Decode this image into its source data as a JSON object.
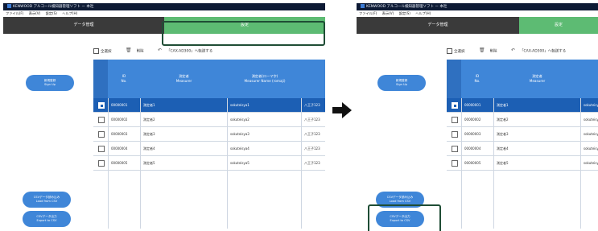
{
  "window": {
    "title": "KENWOOD アルコール検知器管理ソフト  ー 本社",
    "menu": [
      "ファイル(F)",
      "表示(V)",
      "設定(S)",
      "ヘルプ(H)"
    ]
  },
  "tabs": {
    "data_management": "データ管理",
    "settings": "設定"
  },
  "toolbar": {
    "select_all": "全選択",
    "delete": "削除",
    "send": "「CAX-AD300」へ転送する"
  },
  "buttons": {
    "new_register": [
      "新規登録",
      "Sign Up"
    ],
    "load_csv": [
      "CSVデータ読み込み",
      "Load from CSV"
    ],
    "export_csv": [
      "CSVデータ出力",
      "Export to CSV"
    ]
  },
  "table": {
    "headers": {
      "id": [
        "ID",
        "No."
      ],
      "measurer": [
        "測定者",
        "Measurer"
      ],
      "name_romaji": [
        "測定者(ローマ字)",
        "Measurer Name (romaji)"
      ]
    },
    "rows": [
      {
        "id": "00000001",
        "measurer": "測定者1",
        "romaji": "sokuteisya1",
        "location": "八王子123",
        "selected": true
      },
      {
        "id": "00000002",
        "measurer": "測定者2",
        "romaji": "sokuteisya2",
        "location": "八王子123",
        "selected": false
      },
      {
        "id": "00000003",
        "measurer": "測定者3",
        "romaji": "sokuteisya3",
        "location": "八王子123",
        "selected": false
      },
      {
        "id": "00000004",
        "measurer": "測定者4",
        "romaji": "sokuteisya4",
        "location": "八王子123",
        "selected": false
      },
      {
        "id": "00000005",
        "measurer": "測定者5",
        "romaji": "sokuteisya5",
        "location": "八王子123",
        "selected": false
      }
    ]
  },
  "colors": {
    "accent_blue": "#3f86d8",
    "selected_row": "#1c5fb4",
    "tab_green": "#5dbb73",
    "highlight_box": "#1f4d35",
    "arrow": "#111111"
  },
  "icons": {
    "delete": "trash-icon",
    "send": "send-arrow-icon",
    "arrow": "right-arrow-icon"
  }
}
